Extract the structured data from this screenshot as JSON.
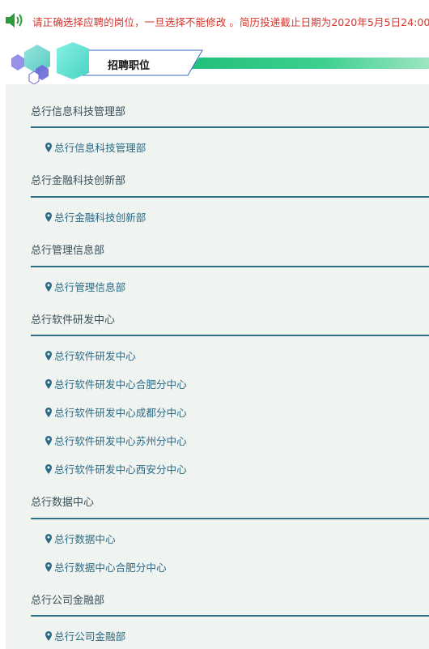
{
  "notice": {
    "text": "请正确选择应聘的岗位，一旦选择不能修改 。简历投递截止日期为2020年5月5日24:00"
  },
  "section": {
    "title": "招聘职位"
  },
  "colors": {
    "notice_text": "#d7362e",
    "accent_green": "#2ec27a",
    "dept_line": "#2f6f86",
    "panel_bg": "#eff4f1",
    "position_text": "#2b6a86"
  },
  "departments": [
    {
      "name": "总行信息科技管理部",
      "positions": [
        "总行信息科技管理部"
      ]
    },
    {
      "name": "总行金融科技创新部",
      "positions": [
        "总行金融科技创新部"
      ]
    },
    {
      "name": "总行管理信息部",
      "positions": [
        "总行管理信息部"
      ]
    },
    {
      "name": "总行软件研发中心",
      "positions": [
        "总行软件研发中心",
        "总行软件研发中心合肥分中心",
        "总行软件研发中心成都分中心",
        "总行软件研发中心苏州分中心",
        "总行软件研发中心西安分中心"
      ]
    },
    {
      "name": "总行数据中心",
      "positions": [
        "总行数据中心",
        "总行数据中心合肥分中心"
      ]
    },
    {
      "name": "总行公司金融部",
      "positions": [
        "总行公司金融部"
      ]
    }
  ]
}
